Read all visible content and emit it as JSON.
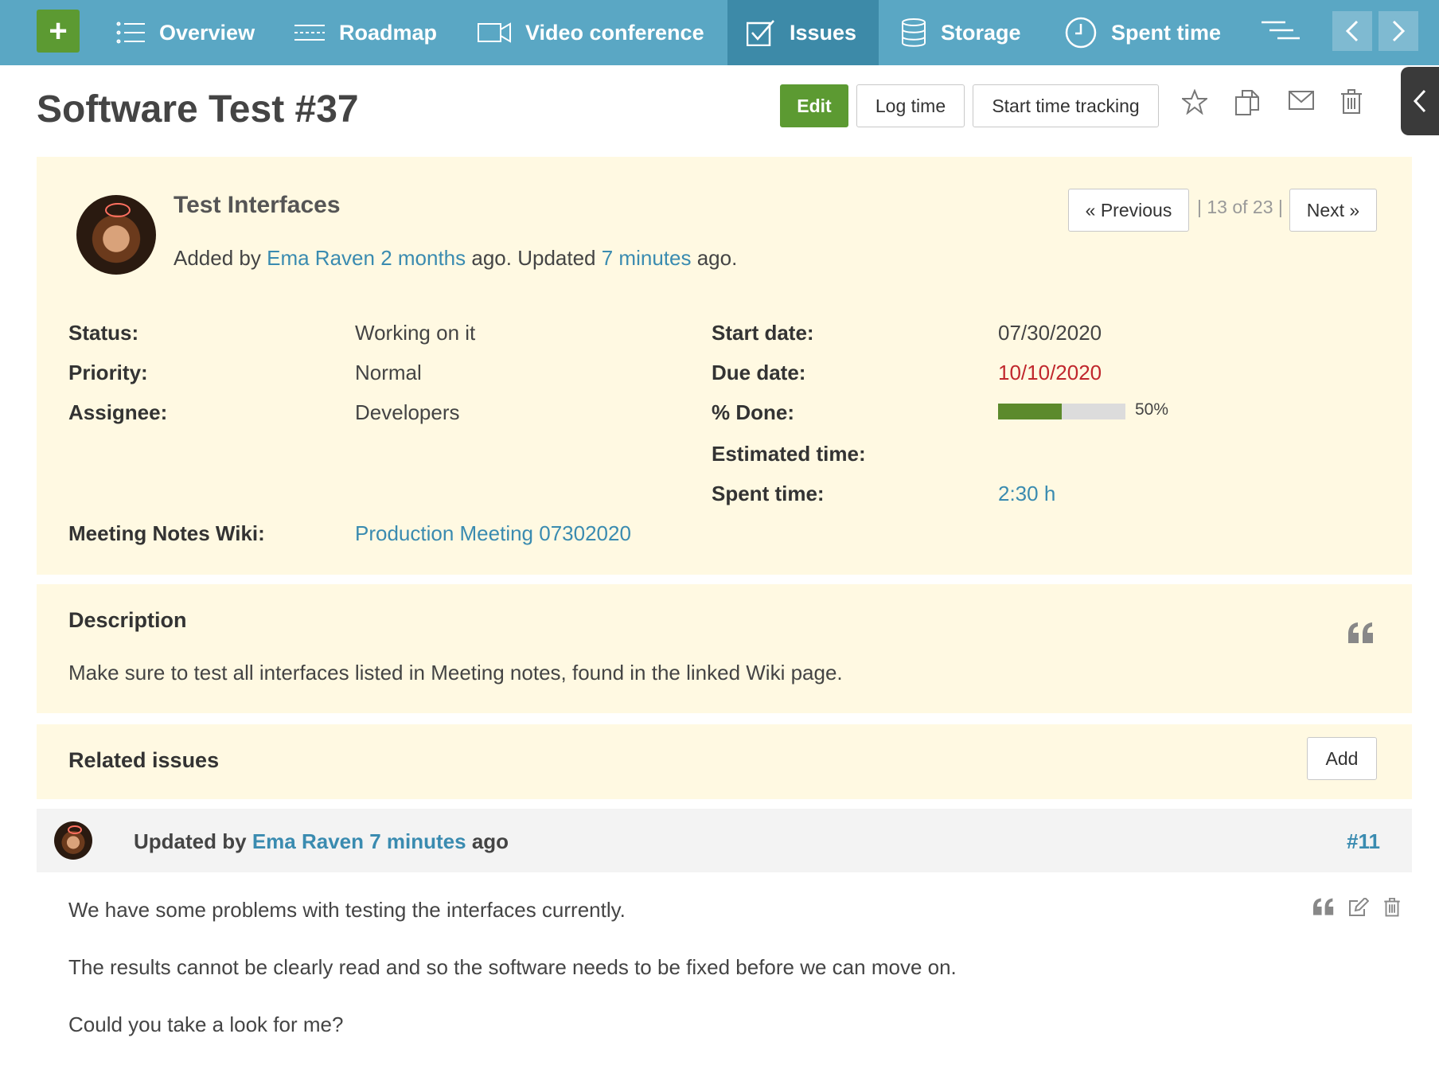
{
  "nav": {
    "plus_label": "+",
    "items": [
      {
        "label": "Overview",
        "icon": "list-icon"
      },
      {
        "label": "Roadmap",
        "icon": "roadmap-icon"
      },
      {
        "label": "Video conference",
        "icon": "video-icon"
      },
      {
        "label": "Issues",
        "icon": "checkbox-icon",
        "active": true
      },
      {
        "label": "Storage",
        "icon": "database-icon"
      },
      {
        "label": "Spent time",
        "icon": "clock-icon"
      }
    ]
  },
  "title_row": {
    "title": "Software Test #37",
    "edit_label": "Edit",
    "log_time_label": "Log time",
    "start_tracking_label": "Start time tracking"
  },
  "issue": {
    "subject": "Test Interfaces",
    "meta": {
      "added_by": "Added by",
      "author": "Ema Raven",
      "created_ago": "2 months",
      "ago_updated": "ago. Updated",
      "updated_ago": "7 minutes",
      "ago_end": "ago."
    },
    "pager": {
      "previous": "« Previous",
      "count": "| 13 of 23 |",
      "next": "Next »"
    },
    "attributes": {
      "status_label": "Status:",
      "status": "Working on it",
      "priority_label": "Priority:",
      "priority": "Normal",
      "assignee_label": "Assignee:",
      "assignee": "Developers",
      "start_date_label": "Start date:",
      "start_date": "07/30/2020",
      "due_date_label": "Due date:",
      "due_date": "10/10/2020",
      "done_label": "% Done:",
      "done_percent": 50,
      "done_text": "50%",
      "estimated_label": "Estimated time:",
      "spent_label": "Spent time:",
      "spent": "2:30 h",
      "wiki_label": "Meeting Notes Wiki:",
      "wiki": "Production Meeting 07302020"
    }
  },
  "description": {
    "heading": "Description",
    "text": "Make sure to test all interfaces listed in Meeting notes, found in the linked Wiki page."
  },
  "related": {
    "heading": "Related issues",
    "add_label": "Add"
  },
  "journal": {
    "updated_by": "Updated by",
    "author": "Ema Raven",
    "time": "7 minutes",
    "ago": "ago",
    "number": "#11",
    "paragraphs": [
      "We have some problems with testing the interfaces currently.",
      "The results cannot be clearly read and so the software needs to be fixed before we can move on.",
      "Could you take a look for me?"
    ]
  },
  "colors": {
    "nav_bg": "#5aa7c4",
    "nav_active": "#3d8aa8",
    "green": "#5c9a32",
    "panel_bg": "#fff9e2",
    "link": "#3a8bb0",
    "due_red": "#c0272d"
  }
}
